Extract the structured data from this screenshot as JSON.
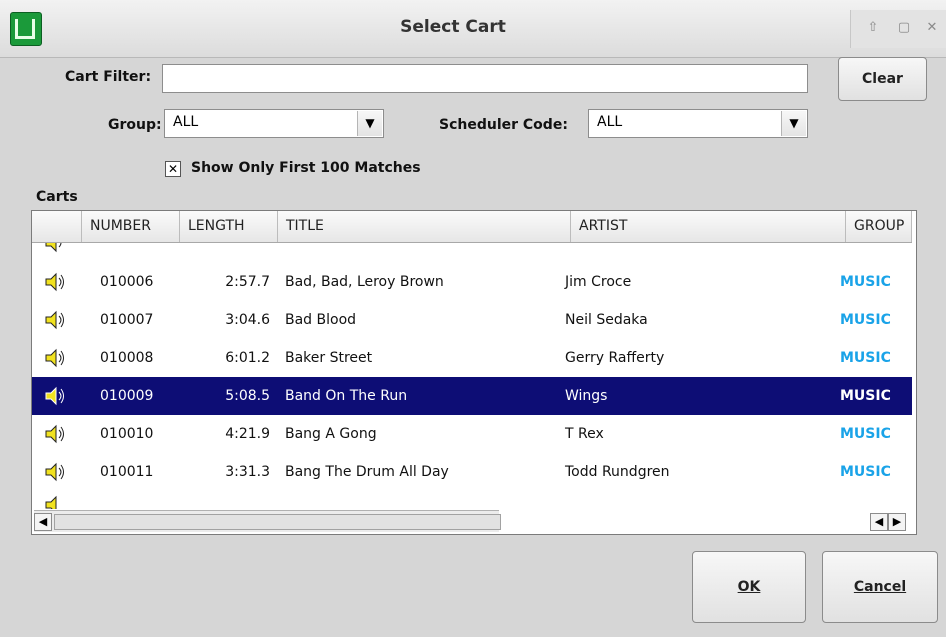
{
  "window": {
    "title": "Select Cart"
  },
  "filter": {
    "label": "Cart Filter:",
    "value": "",
    "clear_label": "Clear"
  },
  "group": {
    "label": "Group:",
    "value": "ALL"
  },
  "scheduler": {
    "label": "Scheduler Code:",
    "value": "ALL"
  },
  "show_first": {
    "label": "Show Only First 100 Matches",
    "checked": true
  },
  "carts_label": "Carts",
  "columns": [
    "NUMBER",
    "LENGTH",
    "TITLE",
    "ARTIST",
    "GROUP"
  ],
  "rows": [
    {
      "number": "010006",
      "length": "2:57.7",
      "title": "Bad, Bad, Leroy Brown",
      "artist": "Jim Croce",
      "group": "MUSIC"
    },
    {
      "number": "010007",
      "length": "3:04.6",
      "title": "Bad Blood",
      "artist": "Neil Sedaka",
      "group": "MUSIC"
    },
    {
      "number": "010008",
      "length": "6:01.2",
      "title": "Baker Street",
      "artist": "Gerry Rafferty",
      "group": "MUSIC"
    },
    {
      "number": "010009",
      "length": "5:08.5",
      "title": "Band On The Run",
      "artist": "Wings",
      "group": "MUSIC",
      "selected": true
    },
    {
      "number": "010010",
      "length": "4:21.9",
      "title": "Bang A Gong",
      "artist": "T Rex",
      "group": "MUSIC"
    },
    {
      "number": "010011",
      "length": "3:31.3",
      "title": "Bang The Drum All Day",
      "artist": "Todd Rundgren",
      "group": "MUSIC"
    }
  ],
  "buttons": {
    "ok_label": "OK",
    "cancel_label": "Cancel"
  }
}
